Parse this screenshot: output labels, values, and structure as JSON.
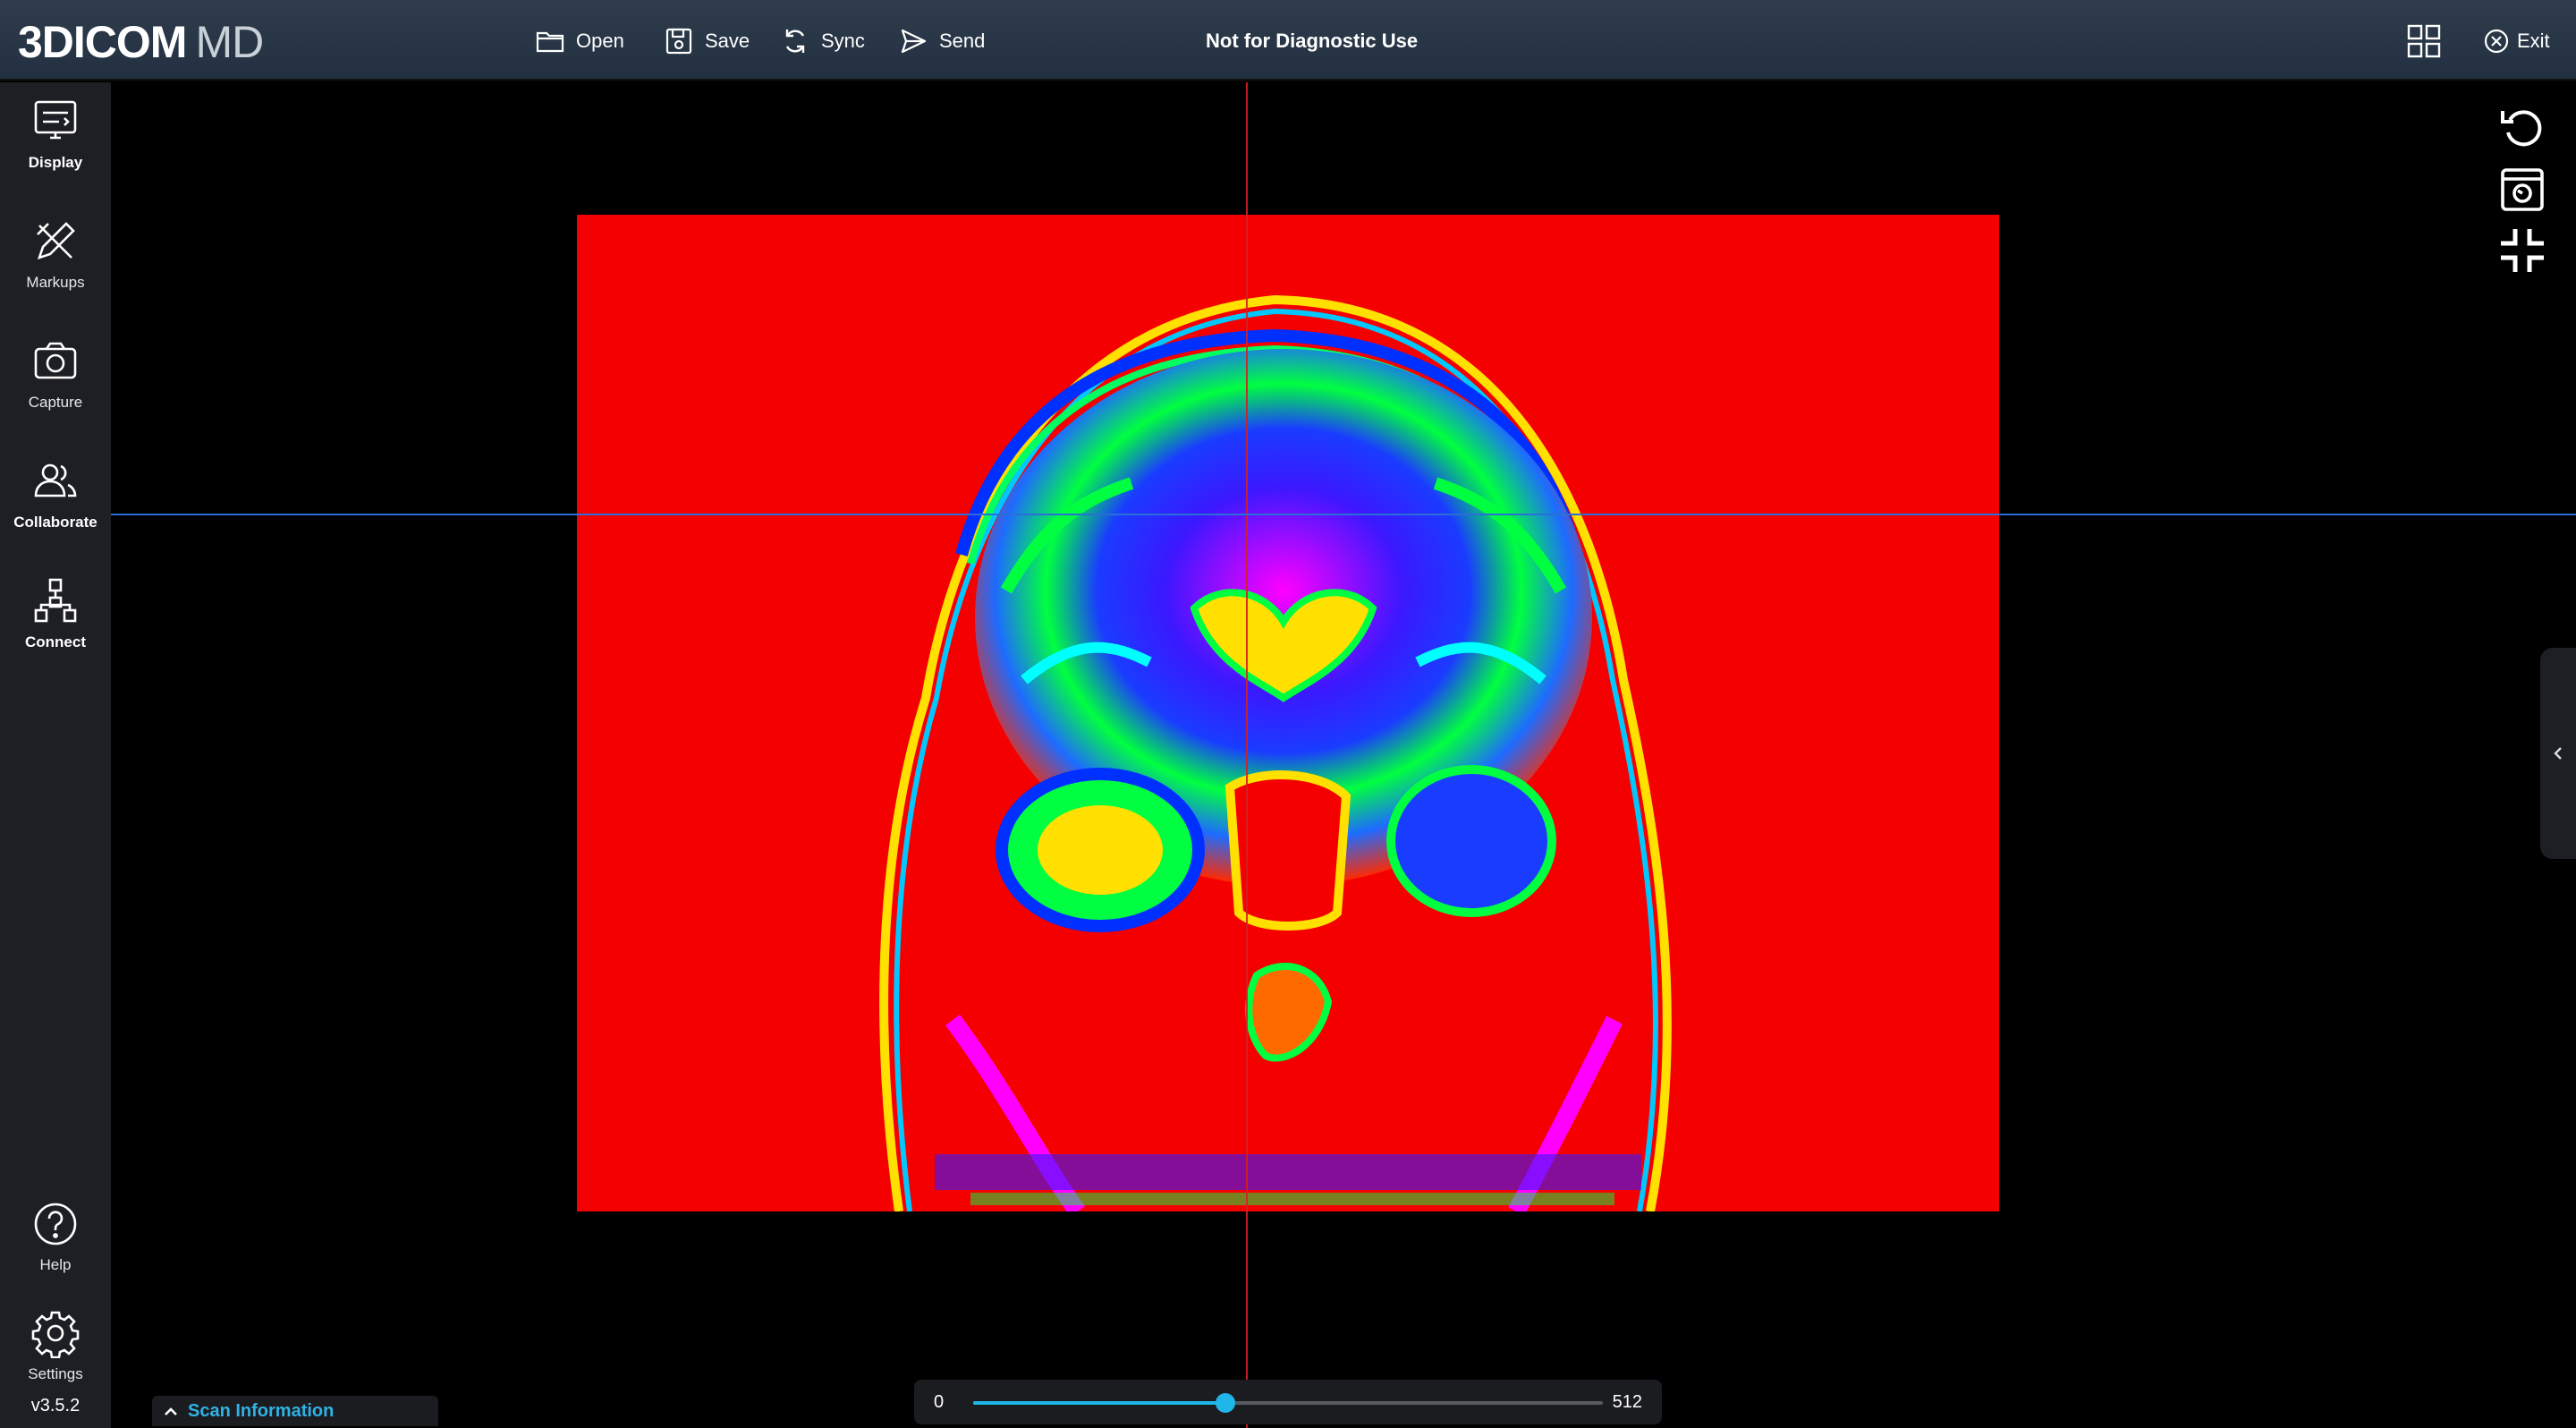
{
  "app": {
    "logo_main": "3DICOM",
    "logo_sub": "MD",
    "disclaimer": "Not for Diagnostic Use"
  },
  "toolbar": {
    "open_label": "Open",
    "save_label": "Save",
    "sync_label": "Sync",
    "send_label": "Send",
    "exit_label": "Exit"
  },
  "sidebar": {
    "items": [
      {
        "label": "Display",
        "icon": "display-icon"
      },
      {
        "label": "Markups",
        "icon": "markups-icon"
      },
      {
        "label": "Capture",
        "icon": "camera-icon"
      },
      {
        "label": "Collaborate",
        "icon": "collaborate-icon"
      },
      {
        "label": "Connect",
        "icon": "connect-icon"
      }
    ],
    "help_label": "Help",
    "settings_label": "Settings",
    "version": "v3.5.2"
  },
  "viewer": {
    "slice_min": "0",
    "slice_max": "512",
    "slice_position": 0.4,
    "colors": {
      "background": "#f50000",
      "crosshair_vertical": "#d32020",
      "crosshair_horizontal": "#2a6fd6",
      "accent": "#1fb6e8"
    }
  },
  "scan_info": {
    "label": "Scan Information"
  }
}
